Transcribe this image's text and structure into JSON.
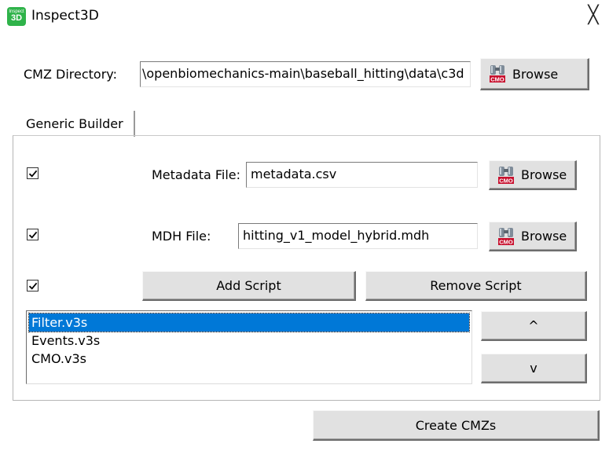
{
  "window": {
    "title": "Inspect3D",
    "app_icon_small": "Inspect",
    "app_icon_big": "3D",
    "close_glyph": "╳"
  },
  "cmz": {
    "label": "CMZ Directory:",
    "path": "\\openbiomechanics-main\\baseball_hitting\\data\\c3d",
    "browse_label": "Browse"
  },
  "tabs": [
    {
      "label": "Generic Builder",
      "active": true
    }
  ],
  "metadata": {
    "checked": true,
    "label": "Metadata File:",
    "value": "metadata.csv",
    "browse_label": "Browse"
  },
  "mdh": {
    "checked": true,
    "label": "MDH File:",
    "value": "hitting_v1_model_hybrid.mdh",
    "browse_label": "Browse"
  },
  "scripts": {
    "checked": true,
    "add_label": "Add Script",
    "remove_label": "Remove Script",
    "items": [
      {
        "label": "Filter.v3s",
        "selected": true
      },
      {
        "label": "Events.v3s",
        "selected": false
      },
      {
        "label": "CMO.v3s",
        "selected": false
      }
    ],
    "up_label": "^",
    "down_label": "v"
  },
  "create_label": "Create CMZs",
  "icons": {
    "browse": "binoculars-cmo-icon",
    "checkbox": "checkmark-icon"
  },
  "colors": {
    "app_icon": "#2fb34a",
    "selection": "#0078d7",
    "button_face": "#e1e1e1"
  }
}
